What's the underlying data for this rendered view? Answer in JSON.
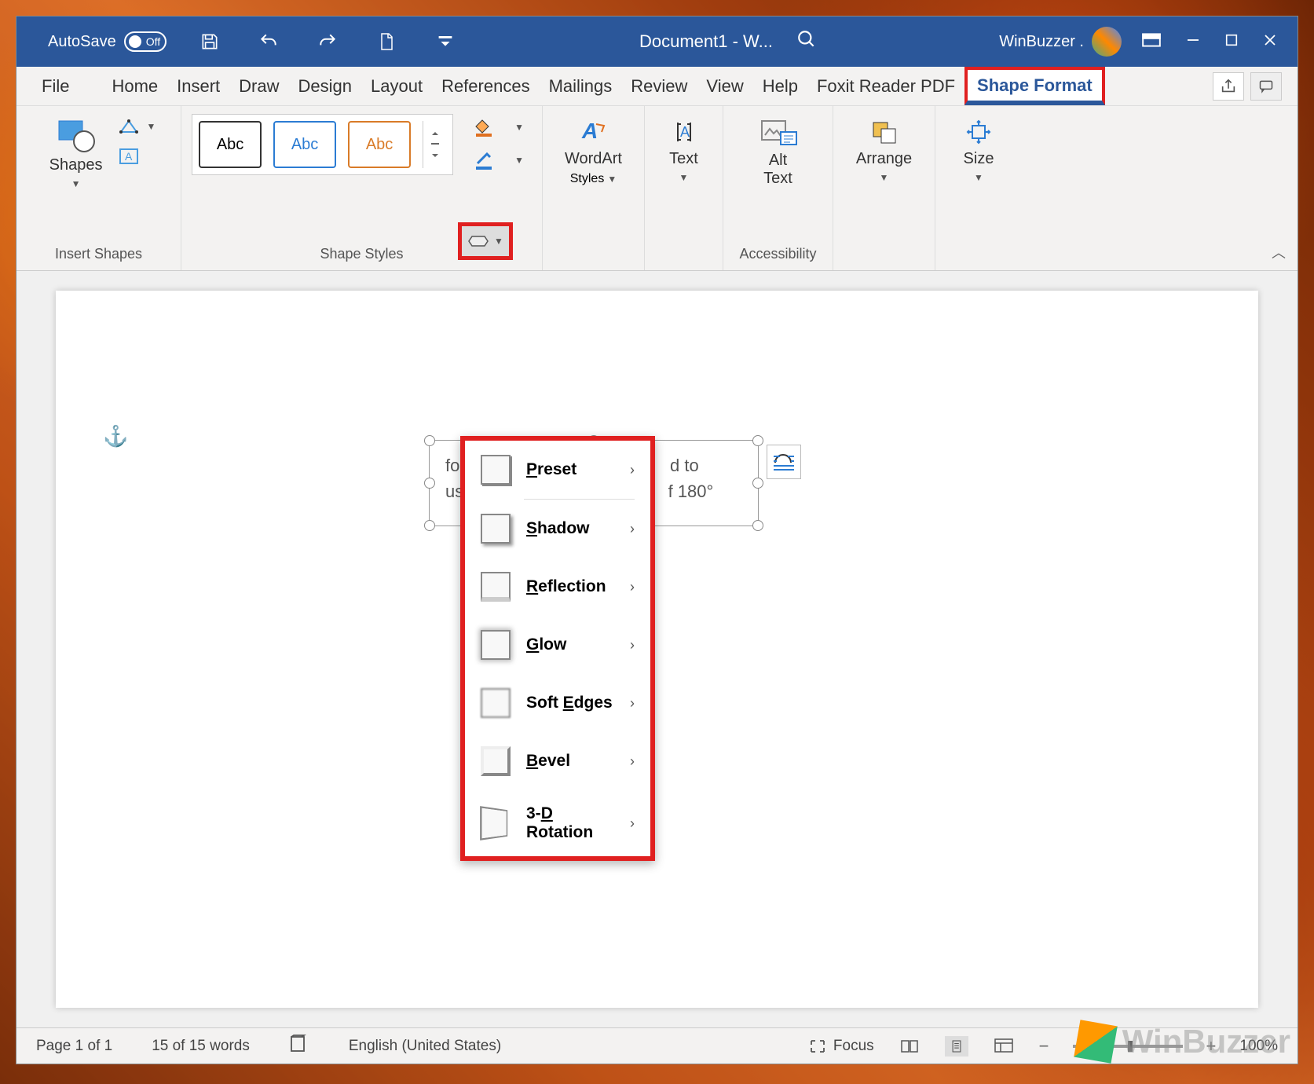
{
  "titlebar": {
    "autosave_label": "AutoSave",
    "autosave_state": "Off",
    "doc_title": "Document1  -  W...",
    "user_name": "WinBuzzer ."
  },
  "tabs": {
    "file": "File",
    "home": "Home",
    "insert": "Insert",
    "draw": "Draw",
    "design": "Design",
    "layout": "Layout",
    "references": "References",
    "mailings": "Mailings",
    "review": "Review",
    "view": "View",
    "help": "Help",
    "foxit": "Foxit Reader PDF",
    "shape_format": "Shape Format"
  },
  "ribbon": {
    "shapes_label": "Shapes",
    "insert_shapes_group": "Insert Shapes",
    "shape_styles_group": "Shape Styles",
    "style_abc": "Abc",
    "wordart_label": "WordArt",
    "wordart_styles": "Styles",
    "text_label": "Text",
    "alt_text_label": "Alt\nText",
    "accessibility_group": "Accessibility",
    "arrange_label": "Arrange",
    "size_label": "Size"
  },
  "dropdown": {
    "preset": "Preset",
    "shadow": "Shadow",
    "reflection": "Reflection",
    "glow": "Glow",
    "soft_edges": "Soft Edges",
    "bevel": "Bevel",
    "rotation": "3-D Rotation"
  },
  "textbox": {
    "line1": "for u",
    "line1b": "d to",
    "line2": "use ",
    "line2b": "f 180°"
  },
  "statusbar": {
    "page": "Page 1 of 1",
    "words": "15 of 15 words",
    "language": "English (United States)",
    "focus": "Focus",
    "zoom": "100%"
  },
  "watermark": "WinBuzzer"
}
